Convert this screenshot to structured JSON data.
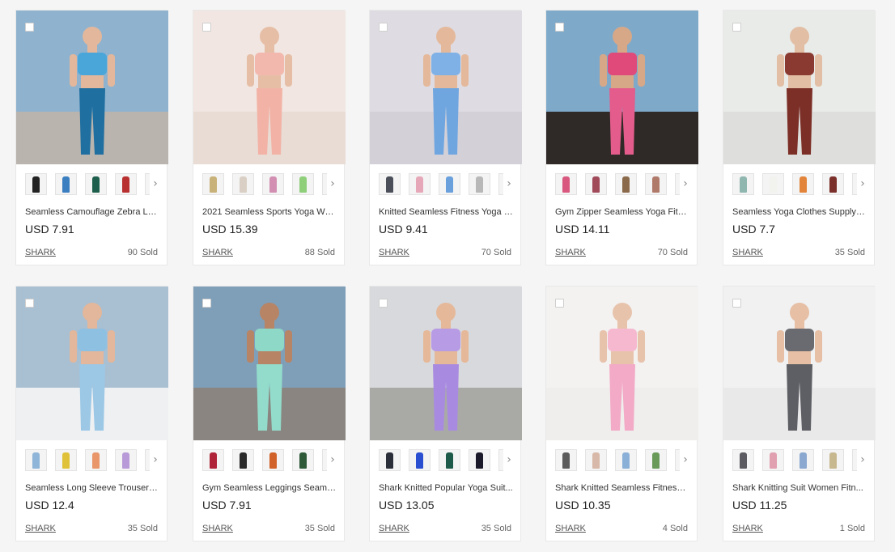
{
  "products": [
    {
      "title": "Seamless Camouflage Zebra Le...",
      "price": "USD 7.91",
      "seller": "SHARK",
      "sold": "90 Sold",
      "bg": "#8fb3cf",
      "ground": "#b9b4ad",
      "top": "#4aa6d8",
      "bottom": "#1f6fa0",
      "skin": "#e3b79b",
      "swatches": [
        "#222222",
        "#3c7fc0",
        "#1e5e4c",
        "#b8302f",
        "#d8d8d8"
      ]
    },
    {
      "title": "2021 Seamless Sports Yoga Wor...",
      "price": "USD 15.39",
      "seller": "SHARK",
      "sold": "88 Sold",
      "bg": "#f1e6e1",
      "ground": "#e9dcd5",
      "top": "#f3b8ad",
      "bottom": "#f2b3a6",
      "skin": "#e6bea6",
      "swatches": [
        "#c9b27a",
        "#d9cfc4",
        "#d28fb2",
        "#8fcf7a",
        "#cfcfcf"
      ]
    },
    {
      "title": "Knitted Seamless Fitness Yoga S...",
      "price": "USD 9.41",
      "seller": "SHARK",
      "sold": "70 Sold",
      "bg": "#dedbe2",
      "ground": "#d3d0d8",
      "top": "#7fb1e6",
      "bottom": "#6fa6e0",
      "skin": "#e4b99b",
      "swatches": [
        "#4b4f5a",
        "#e6a8b8",
        "#6aa0dc",
        "#b8b8b8",
        "#cfcfcf"
      ]
    },
    {
      "title": "Gym Zipper Seamless Yoga Fitn...",
      "price": "USD 14.11",
      "seller": "SHARK",
      "sold": "70 Sold",
      "bg": "#7fa9c9",
      "ground": "#2f2a27",
      "top": "#e04a7a",
      "bottom": "#e35c8c",
      "skin": "#d6a888",
      "swatches": [
        "#d9587f",
        "#a04a5a",
        "#8a6a4a",
        "#b07a6a",
        "#cfcfcf"
      ]
    },
    {
      "title": "Seamless Yoga Clothes Supply E...",
      "price": "USD 7.7",
      "seller": "SHARK",
      "sold": "35 Sold",
      "bg": "#e9ebe8",
      "ground": "#dedfdc",
      "top": "#8a3a30",
      "bottom": "#7c2f27",
      "skin": "#e2bea4",
      "swatches": [
        "#8fb7b0",
        "#f2f2ee",
        "#e2843a",
        "#7a2f2a",
        "#e8a8c0"
      ]
    },
    {
      "title": "Seamless Long Sleeve Trousers ...",
      "price": "USD 12.4",
      "seller": "SHARK",
      "sold": "35 Sold",
      "bg": "#a9bfd2",
      "ground": "#eef0f2",
      "top": "#8ec0e2",
      "bottom": "#9cc8e6",
      "skin": "#e2b79b",
      "swatches": [
        "#8fb5d8",
        "#e0c23a",
        "#e8966a",
        "#b99ad8",
        "#cfcfcf"
      ]
    },
    {
      "title": "Gym Seamless Leggings Seamle...",
      "price": "USD 7.91",
      "seller": "SHARK",
      "sold": "35 Sold",
      "bg": "#7f9fb8",
      "ground": "#8a8580",
      "top": "#8ed8c8",
      "bottom": "#93dccb",
      "skin": "#b78466",
      "swatches": [
        "#b0243a",
        "#2a2a2a",
        "#d0622a",
        "#2f5a3a",
        "#cfcfcf"
      ]
    },
    {
      "title": "Shark Knitted Popular Yoga Suit...",
      "price": "USD 13.05",
      "seller": "SHARK",
      "sold": "35 Sold",
      "bg": "#d8d9dc",
      "ground": "#a9aaa6",
      "top": "#b79be4",
      "bottom": "#a88be0",
      "skin": "#e5b899",
      "swatches": [
        "#2a2f3a",
        "#2a4fd0",
        "#1e5a4a",
        "#1a1a2a",
        "#cfcfcf"
      ]
    },
    {
      "title": "Shark Knitted Seamless Fitness ...",
      "price": "USD 10.35",
      "seller": "SHARK",
      "sold": "4 Sold",
      "bg": "#f3f2f1",
      "ground": "#efeeed",
      "top": "#f5b8cf",
      "bottom": "#f3aac6",
      "skin": "#e8c3ac",
      "swatches": [
        "#5a5a5a",
        "#d8b8a8",
        "#8ab0d8",
        "#6a9a5a",
        "#cfcfcf"
      ]
    },
    {
      "title": "Shark Knitting Suit Women Fitn...",
      "price": "USD 11.25",
      "seller": "SHARK",
      "sold": "1 Sold",
      "bg": "#f1f1f2",
      "ground": "#e9e9ea",
      "top": "#6a6b70",
      "bottom": "#5e5f64",
      "skin": "#e6bfa5",
      "swatches": [
        "#5a5a60",
        "#e0a0b0",
        "#8aa8d0",
        "#c8b890",
        "#cfcfcf"
      ]
    }
  ]
}
